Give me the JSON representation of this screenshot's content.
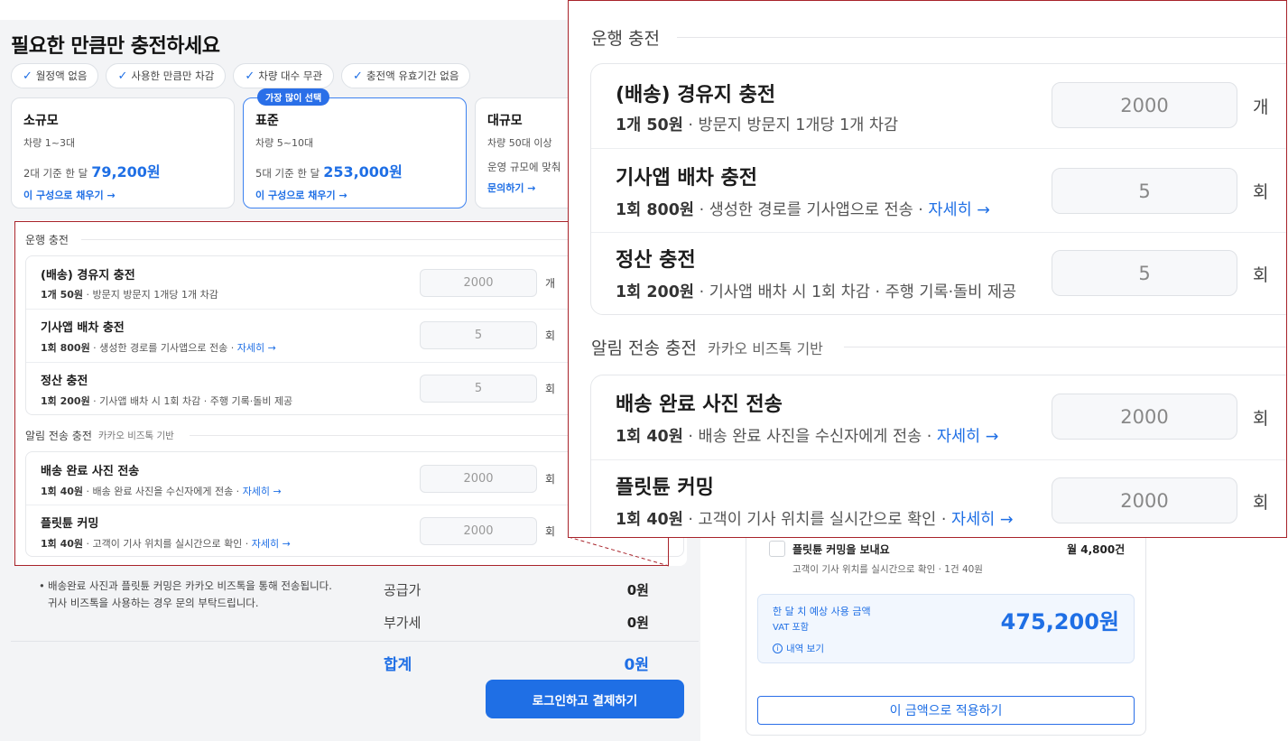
{
  "page": {
    "title": "필요한 만큼만 충전하세요",
    "chips": [
      {
        "icon": "✓",
        "label": "월정액 없음"
      },
      {
        "icon": "✓",
        "label": "사용한 만큼만 차감"
      },
      {
        "icon": "✓",
        "label": "차량 대수 무관"
      },
      {
        "icon": "✓",
        "label": "충전액 유효기간 없음"
      }
    ]
  },
  "plans": [
    {
      "name": "소규모",
      "sub": "차량 1~3대",
      "price_prefix": "2대 기준 한 달",
      "price": "79,200원",
      "link": "이 구성으로 채우기 →"
    },
    {
      "name": "표준",
      "badge": "가장 많이 선택",
      "sub": "차량 5~10대",
      "price_prefix": "5대 기준 한 달",
      "price": "253,000원",
      "link": "이 구성으로 채우기 →"
    },
    {
      "name": "대규모",
      "sub": "차량 50대 이상",
      "price_prefix": "운영 규모에 맞춰",
      "link": "문의하기 →"
    }
  ],
  "sections": {
    "operation": {
      "title": "운행 충전"
    },
    "alert": {
      "title": "알림 전송 충전",
      "tag": "카카오 비즈톡 기반"
    }
  },
  "items": {
    "waypoint": {
      "title": "(배송) 경유지 충전",
      "price": "1개 50원",
      "desc": " · 방문지 방문지 1개당 1개 차감",
      "value": "2000",
      "unit": "개"
    },
    "dispatch": {
      "title": "기사앱 배차 충전",
      "price": "1회 800원",
      "desc": " · 생성한 경로를 기사앱으로 전송 · ",
      "link": "자세히 →",
      "value": "5",
      "unit": "회"
    },
    "settle": {
      "title": "정산 충전",
      "price": "1회 200원",
      "desc": " · 기사앱 배차 시 1회 차감 · 주행 기록·돌비 제공",
      "value": "5",
      "unit": "회"
    },
    "photo": {
      "title": "배송 완료 사진 전송",
      "price": "1회 40원",
      "desc": " · 배송 완료 사진을 수신자에게 전송 · ",
      "link": "자세히 →",
      "value": "2000",
      "unit": "회"
    },
    "plitun": {
      "title": "플릿튠 커밍",
      "price": "1회 40원",
      "desc": " · 고객이 기사 위치를 실시간으로 확인 · ",
      "link": "자세히 →",
      "value": "2000",
      "unit": "회"
    }
  },
  "notes": {
    "bullet": "•",
    "line1": "배송완료 사진과 플릿튠 커밍은 카카오 비즈톡을 통해 전송됩니다.",
    "line2": "귀사 비즈톡을 사용하는 경우 문의 부탁드립니다."
  },
  "summary": {
    "supply_label": "공급가",
    "supply_value": "0원",
    "vat_label": "부가세",
    "vat_value": "0원",
    "total_label": "합계",
    "total_value": "0원",
    "pay_button": "로그인하고 결제하기"
  },
  "right_panel": {
    "item_title": "플릿튠 커밍을 보내요",
    "item_price": "월 4,800건",
    "item_desc": "고객이 기사 위치를 실시간으로 확인 · 1건 40원",
    "estimate_label": "한 달 치 예상 사용 금액",
    "estimate_vat": "VAT 포함",
    "estimate_amount": "475,200원",
    "detail_icon": "i",
    "detail_link": "내역 보기",
    "apply_button": "이 금액으로 적용하기"
  },
  "colors": {
    "accent": "#1f6fe5",
    "highlight_border": "#a8232a"
  }
}
